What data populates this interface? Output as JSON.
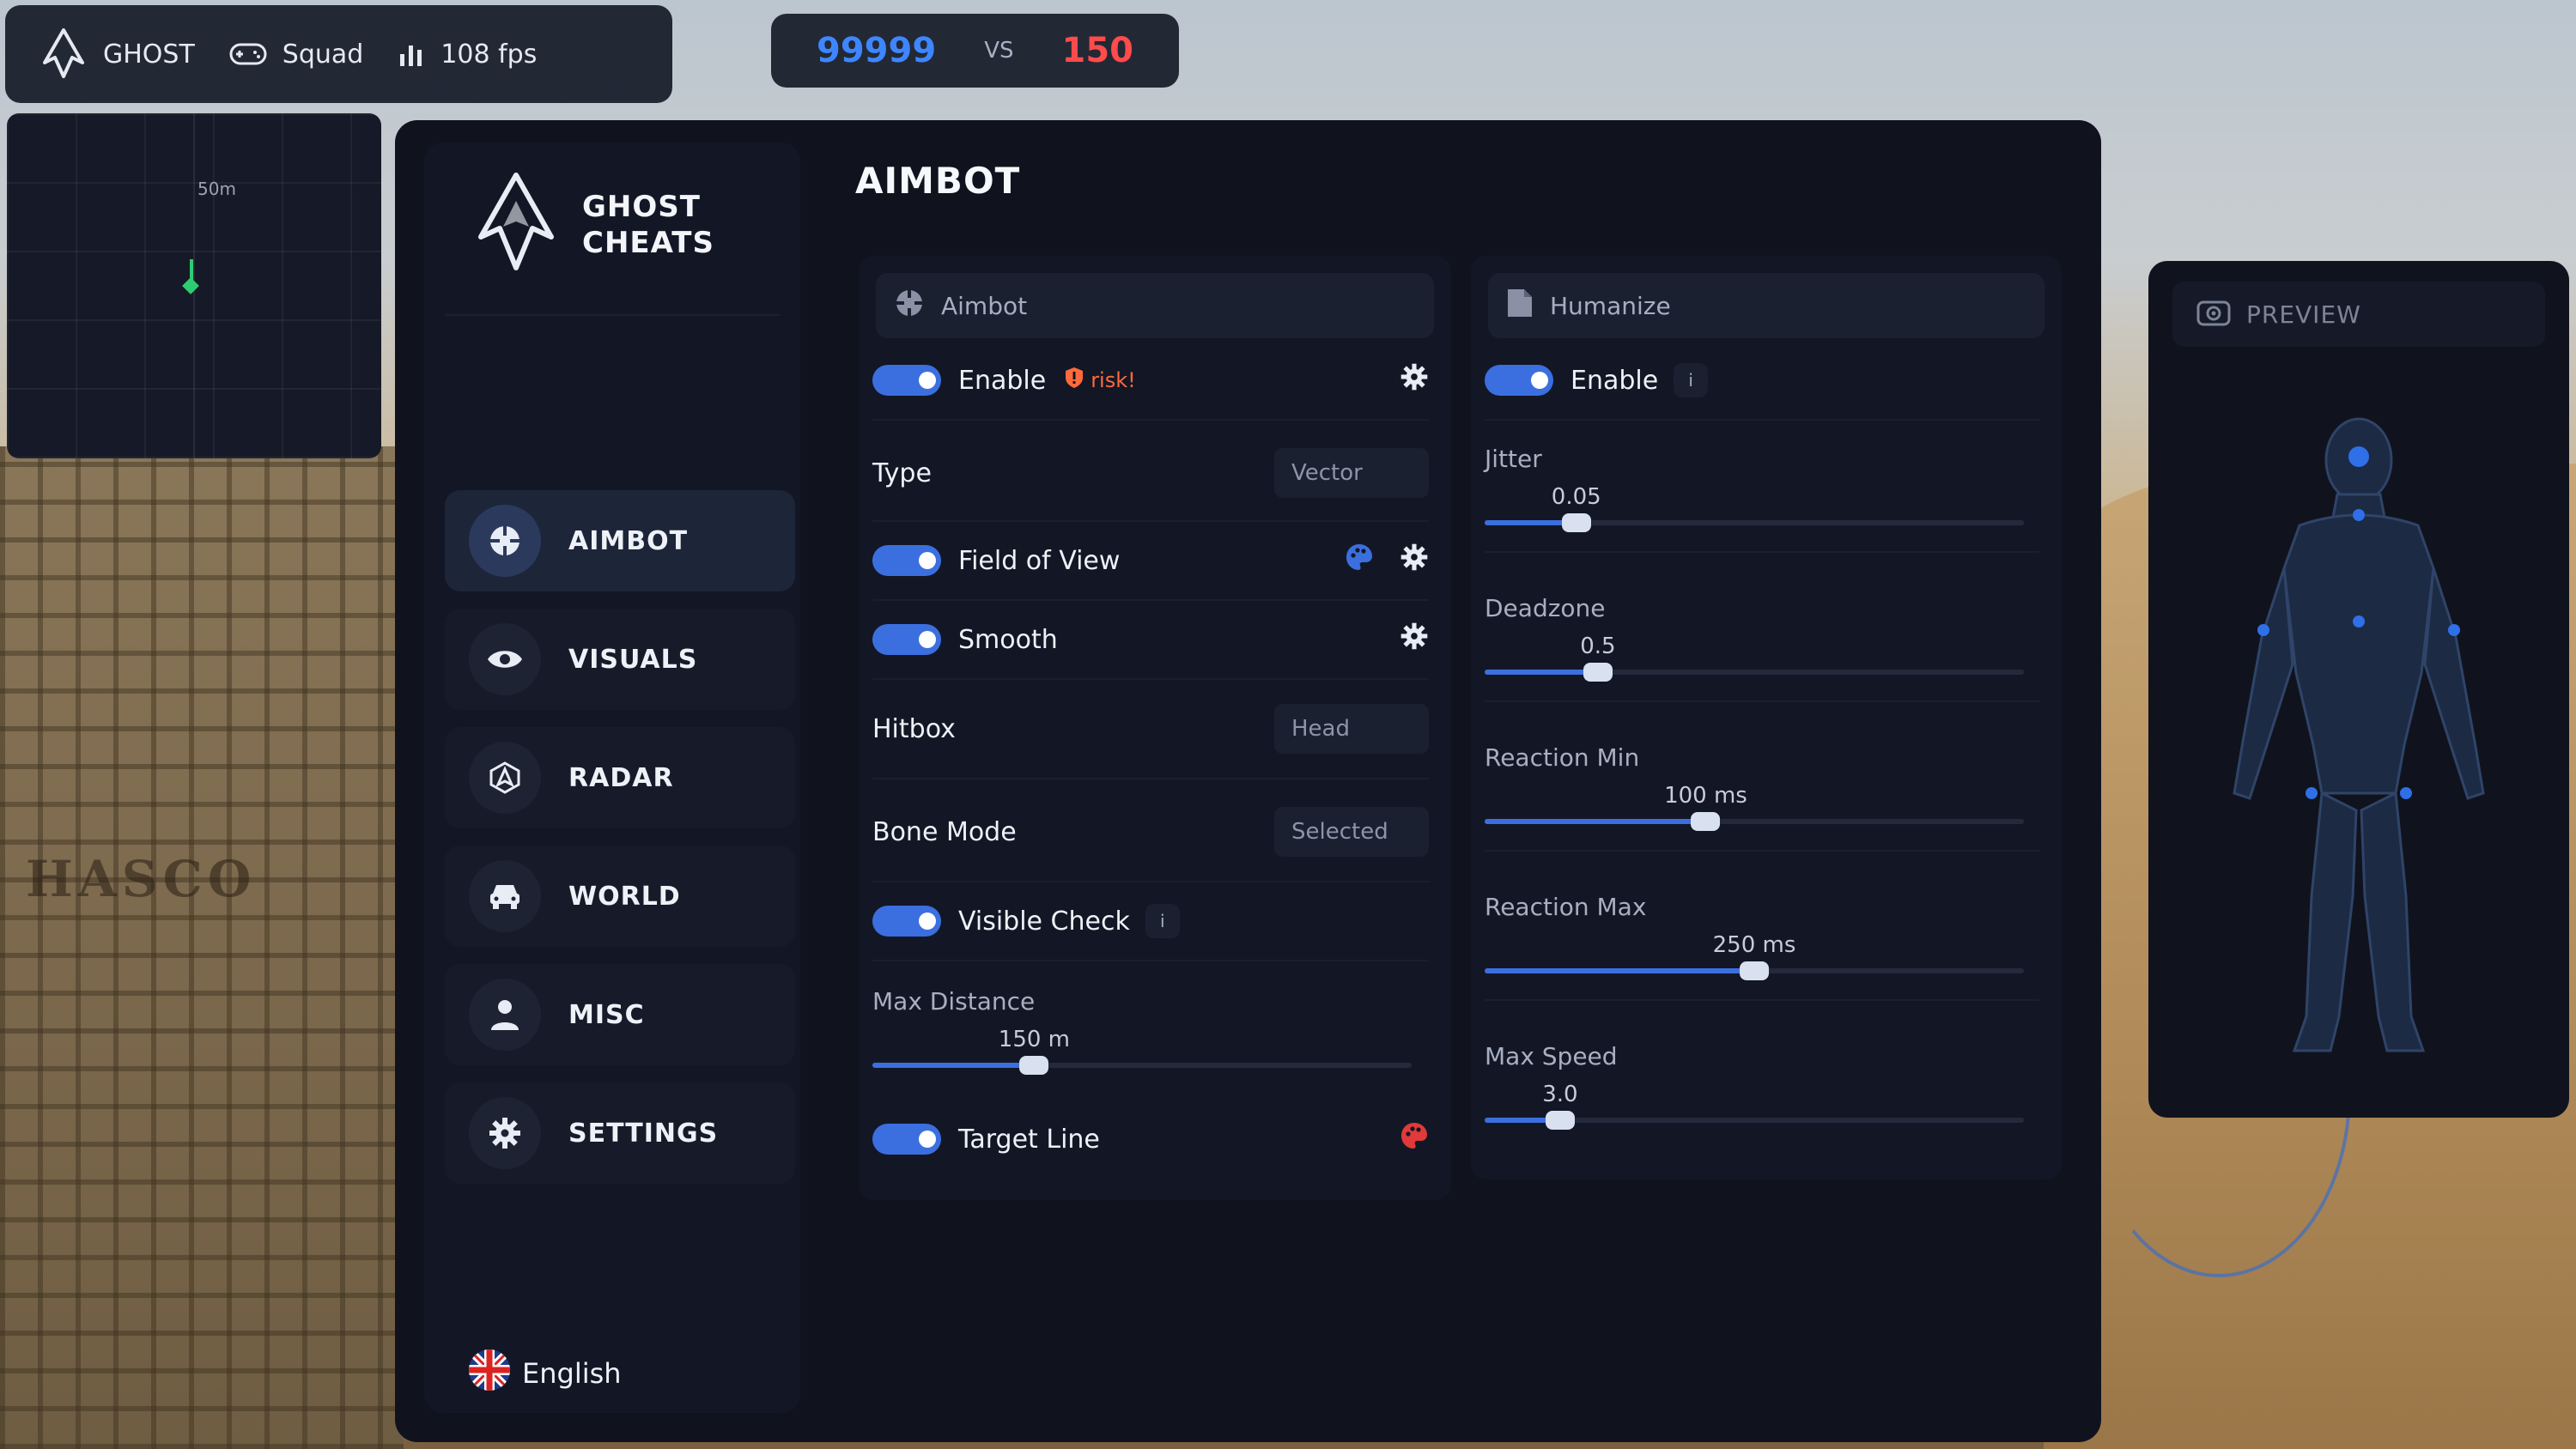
{
  "topbar": {
    "app_name": "GHOST",
    "mode": "Squad",
    "fps": "108 fps"
  },
  "score": {
    "team_a": "99999",
    "vs": "VS",
    "team_b": "150"
  },
  "minimap": {
    "distance_label": "50m"
  },
  "brand": {
    "line1": "GHOST",
    "line2": "CHEATS"
  },
  "nav": [
    {
      "label": "AIMBOT",
      "icon": "crosshair-icon",
      "active": true
    },
    {
      "label": "VISUALS",
      "icon": "eye-icon",
      "active": false
    },
    {
      "label": "RADAR",
      "icon": "radar-icon",
      "active": false
    },
    {
      "label": "WORLD",
      "icon": "car-icon",
      "active": false
    },
    {
      "label": "MISC",
      "icon": "user-icon",
      "active": false
    },
    {
      "label": "SETTINGS",
      "icon": "gear-icon",
      "active": false
    }
  ],
  "language": "English",
  "page_title": "AIMBOT",
  "aimbot": {
    "section": "Aimbot",
    "enable_label": "Enable",
    "risk_label": "risk!",
    "type_label": "Type",
    "type_value": "Vector",
    "fov_label": "Field of View",
    "smooth_label": "Smooth",
    "hitbox_label": "Hitbox",
    "hitbox_value": "Head",
    "bone_mode_label": "Bone Mode",
    "bone_mode_value": "Selected",
    "visible_check_label": "Visible Check",
    "info_glyph": "i",
    "max_distance": {
      "label": "Max Distance",
      "value_text": "150 m",
      "fraction": 0.3
    },
    "target_line_label": "Target Line"
  },
  "humanize": {
    "section": "Humanize",
    "enable_label": "Enable",
    "info_glyph": "i",
    "sliders": [
      {
        "label": "Jitter",
        "value_text": "0.05",
        "fraction": 0.17
      },
      {
        "label": "Deadzone",
        "value_text": "0.5",
        "fraction": 0.21
      },
      {
        "label": "Reaction Min",
        "value_text": "100 ms",
        "fraction": 0.41
      },
      {
        "label": "Reaction Max",
        "value_text": "250 ms",
        "fraction": 0.5
      },
      {
        "label": "Max Speed",
        "value_text": "3.0",
        "fraction": 0.14
      }
    ]
  },
  "preview": {
    "title": "PREVIEW"
  },
  "colors": {
    "accent": "#3b6fe0",
    "score_a": "#3d86ff",
    "score_b": "#ff4b4b",
    "risk": "#ff6a3d",
    "panel": "#10131d"
  }
}
